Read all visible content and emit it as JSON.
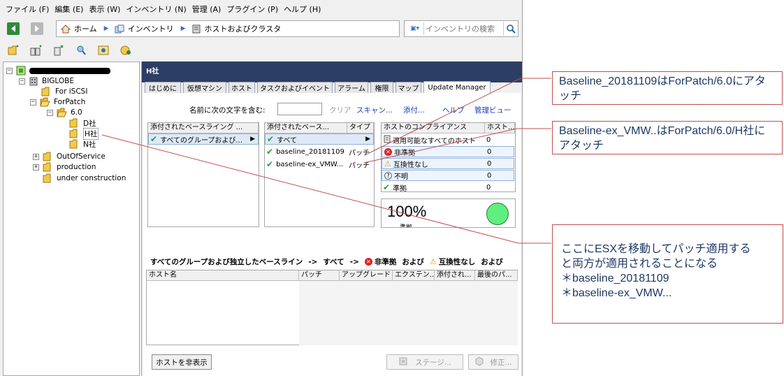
{
  "menubar": {
    "items": [
      "ファイル (F)",
      "編集 (E)",
      "表示 (W)",
      "インベントリ (N)",
      "管理 (A)",
      "プラグイン (P)",
      "ヘルプ (H)"
    ]
  },
  "navbar": {
    "breadcrumb": [
      "ホーム",
      "インベントリ",
      "ホストおよびクラスタ"
    ],
    "search_placeholder": "インベントリの検索"
  },
  "tree": {
    "biglobe": "BIGLOBE",
    "for_iscsi": "For iSCSI",
    "forpatch": "ForPatch",
    "v60": "6.0",
    "d": "D社",
    "h": "H社",
    "n": "N社",
    "outofservice": "OutOfService",
    "production": "production",
    "under_construction": "under construction"
  },
  "panel": {
    "title": "H社",
    "tabs": [
      "はじめに",
      "仮想マシン",
      "ホスト",
      "タスクおよびイベント",
      "アラーム",
      "権限",
      "マップ",
      "Update Manager"
    ],
    "filter_label": "名前に次の文字を含む:",
    "clear": "クリア",
    "scan": "スキャン...",
    "attach": "添付...",
    "help": "ヘルプ",
    "admin_view": "管理ビュー"
  },
  "baselines_left": {
    "header": "添付されたベースライング ...",
    "rows": [
      "すべてのグループおよび..."
    ]
  },
  "baselines_mid": {
    "header_name": "添付されたベース...",
    "header_type": "タイプ",
    "rows": [
      {
        "name": "すべて",
        "type": ""
      },
      {
        "name": "baseline_20181109",
        "type": "パッチ"
      },
      {
        "name": "baseline-ex_VMW...",
        "type": "パッチ"
      }
    ]
  },
  "compliance": {
    "header_name": "ホストのコンプライアンス",
    "header_count": "ホスト...",
    "rows": [
      {
        "label": "適用可能なすべてのホスト",
        "count": "0"
      },
      {
        "label": "非準拠",
        "count": "0"
      },
      {
        "label": "互換性なし",
        "count": "0"
      },
      {
        "label": "不明",
        "count": "0"
      },
      {
        "label": "準拠",
        "count": "0"
      }
    ]
  },
  "status": {
    "percent": "100%",
    "label": "準拠"
  },
  "breadcrumb2": {
    "part1": "すべてのグループおよび独立したベースライン",
    "arrow": "->",
    "part2": "すべて",
    "part3": "非準拠",
    "and1": "および",
    "part4": "互換性なし",
    "and2": "および"
  },
  "hosttable": {
    "columns": [
      "ホスト名",
      "パッチ",
      "アップグレード",
      "エクステン...",
      "添付され...",
      "最後のパ..."
    ]
  },
  "buttons": {
    "hide_hosts": "ホストを非表示",
    "stage": "ステージ...",
    "remediate": "修正..."
  },
  "annotations": {
    "a1": "Baseline_20181109はForPatch/6.0にアタッチ",
    "a2": "Baseline-ex_VMW..はForPatch/6.0/H社にアタッチ",
    "a3_l1": "ここにESXを移動してパッチ適用する",
    "a3_l2": "と両方が適用されることになる",
    "a3_l3": "＊baseline_20181109",
    "a3_l4": "＊baseline-ex_VMW..."
  },
  "colors": {
    "header_bg": "#2c3e64",
    "annotation_border": "#c0504d",
    "annotation_text": "#1f3864",
    "compliant_green": "#5fef7f"
  }
}
